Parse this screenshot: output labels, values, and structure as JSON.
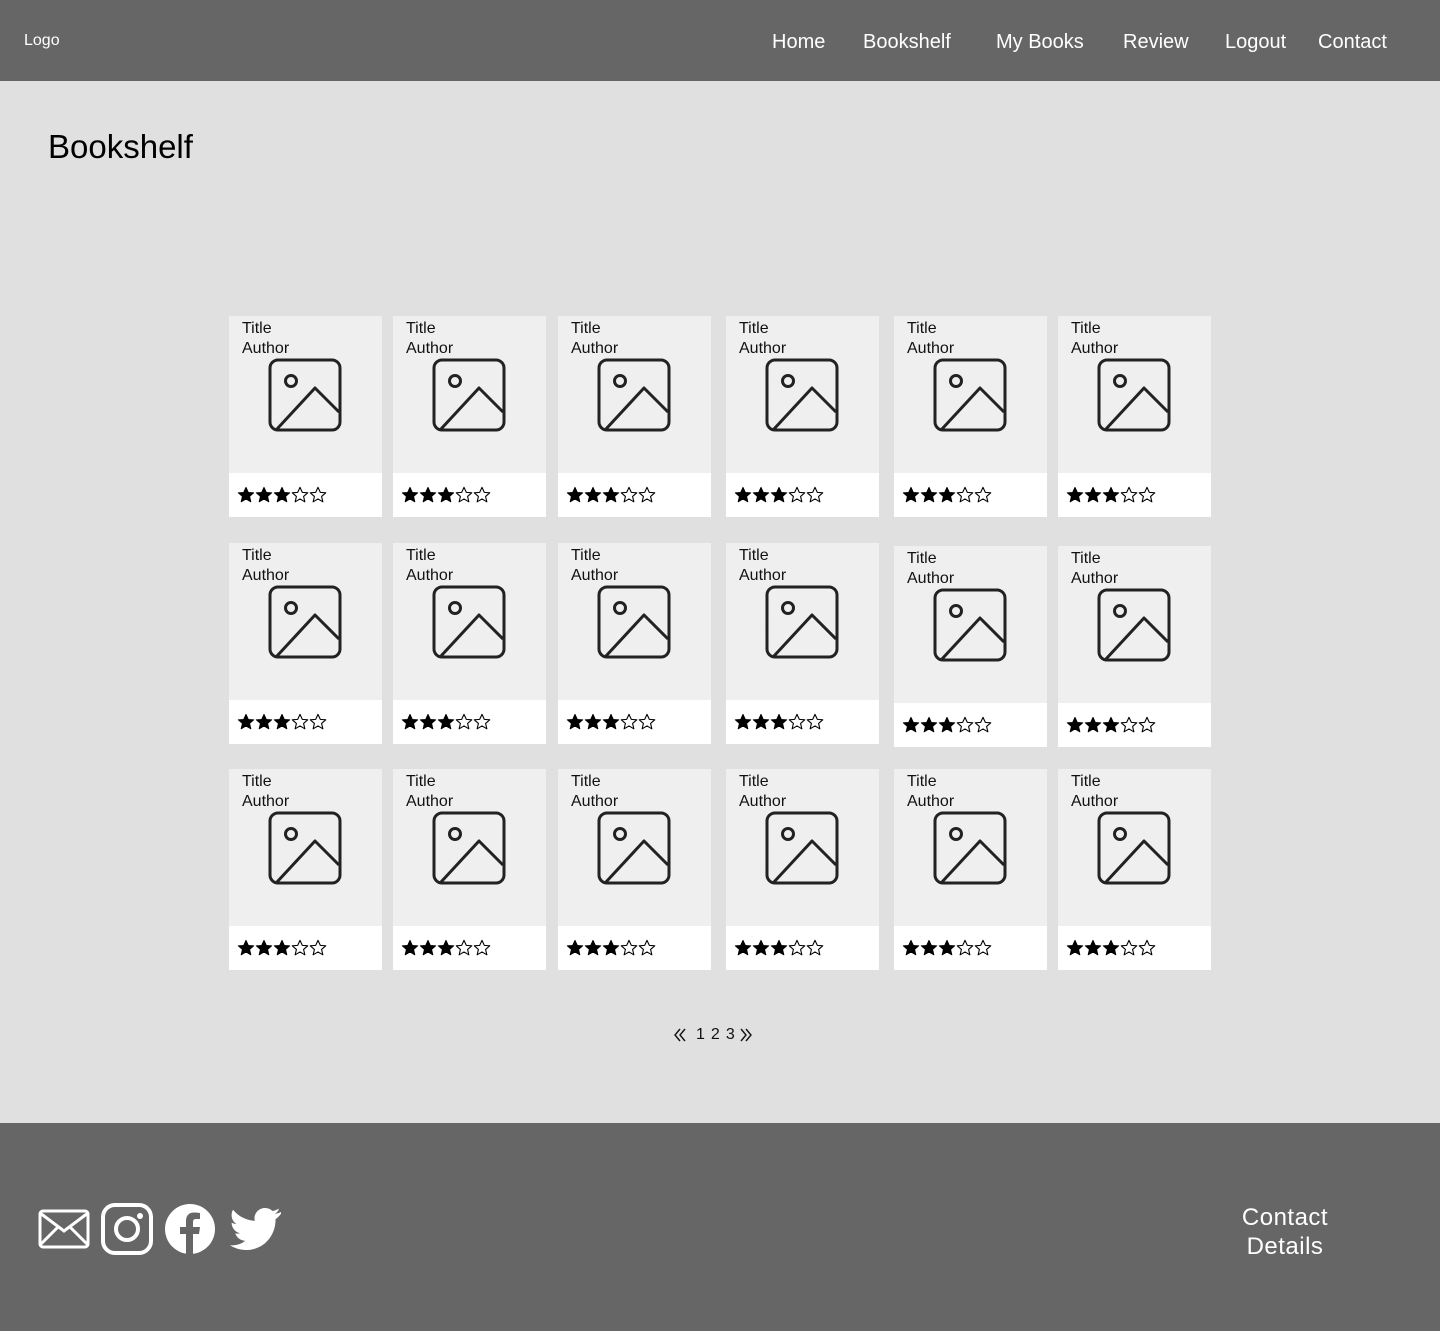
{
  "header": {
    "logo": "Logo",
    "nav": [
      {
        "label": "Home"
      },
      {
        "label": "Bookshelf"
      },
      {
        "label": "My Books"
      },
      {
        "label": "Review"
      },
      {
        "label": "Logout"
      },
      {
        "label": "Contact"
      }
    ]
  },
  "page": {
    "title": "Bookshelf"
  },
  "books": [
    {
      "title": "Title",
      "author": "Author",
      "rating": 3,
      "max_rating": 5,
      "cover_icon": "image-placeholder-icon"
    },
    {
      "title": "Title",
      "author": "Author",
      "rating": 3,
      "max_rating": 5,
      "cover_icon": "image-placeholder-icon"
    },
    {
      "title": "Title",
      "author": "Author",
      "rating": 3,
      "max_rating": 5,
      "cover_icon": "image-placeholder-icon"
    },
    {
      "title": "Title",
      "author": "Author",
      "rating": 3,
      "max_rating": 5,
      "cover_icon": "image-placeholder-icon"
    },
    {
      "title": "Title",
      "author": "Author",
      "rating": 3,
      "max_rating": 5,
      "cover_icon": "image-placeholder-icon"
    },
    {
      "title": "Title",
      "author": "Author",
      "rating": 3,
      "max_rating": 5,
      "cover_icon": "image-placeholder-icon"
    },
    {
      "title": "Title",
      "author": "Author",
      "rating": 3,
      "max_rating": 5,
      "cover_icon": "image-placeholder-icon"
    },
    {
      "title": "Title",
      "author": "Author",
      "rating": 3,
      "max_rating": 5,
      "cover_icon": "image-placeholder-icon"
    },
    {
      "title": "Title",
      "author": "Author",
      "rating": 3,
      "max_rating": 5,
      "cover_icon": "image-placeholder-icon"
    },
    {
      "title": "Title",
      "author": "Author",
      "rating": 3,
      "max_rating": 5,
      "cover_icon": "image-placeholder-icon"
    },
    {
      "title": "Title",
      "author": "Author",
      "rating": 3,
      "max_rating": 5,
      "cover_icon": "image-placeholder-icon"
    },
    {
      "title": "Title",
      "author": "Author",
      "rating": 3,
      "max_rating": 5,
      "cover_icon": "image-placeholder-icon"
    },
    {
      "title": "Title",
      "author": "Author",
      "rating": 3,
      "max_rating": 5,
      "cover_icon": "image-placeholder-icon"
    },
    {
      "title": "Title",
      "author": "Author",
      "rating": 3,
      "max_rating": 5,
      "cover_icon": "image-placeholder-icon"
    },
    {
      "title": "Title",
      "author": "Author",
      "rating": 3,
      "max_rating": 5,
      "cover_icon": "image-placeholder-icon"
    },
    {
      "title": "Title",
      "author": "Author",
      "rating": 3,
      "max_rating": 5,
      "cover_icon": "image-placeholder-icon"
    },
    {
      "title": "Title",
      "author": "Author",
      "rating": 3,
      "max_rating": 5,
      "cover_icon": "image-placeholder-icon"
    },
    {
      "title": "Title",
      "author": "Author",
      "rating": 3,
      "max_rating": 5,
      "cover_icon": "image-placeholder-icon"
    }
  ],
  "pagination": {
    "prev_icon": "double-chevron-left-icon",
    "pages": [
      "1",
      "2",
      "3"
    ],
    "next_icon": "double-chevron-right-icon"
  },
  "footer": {
    "social_icons": [
      "mail-icon",
      "instagram-icon",
      "facebook-icon",
      "twitter-icon"
    ],
    "contact_line1": "Contact",
    "contact_line2": "Details"
  },
  "colors": {
    "bar": "#666666",
    "page_bg": "#e0e0e0",
    "card_cover": "#efefef",
    "card_footer": "#ffffff",
    "star": "#000000"
  }
}
